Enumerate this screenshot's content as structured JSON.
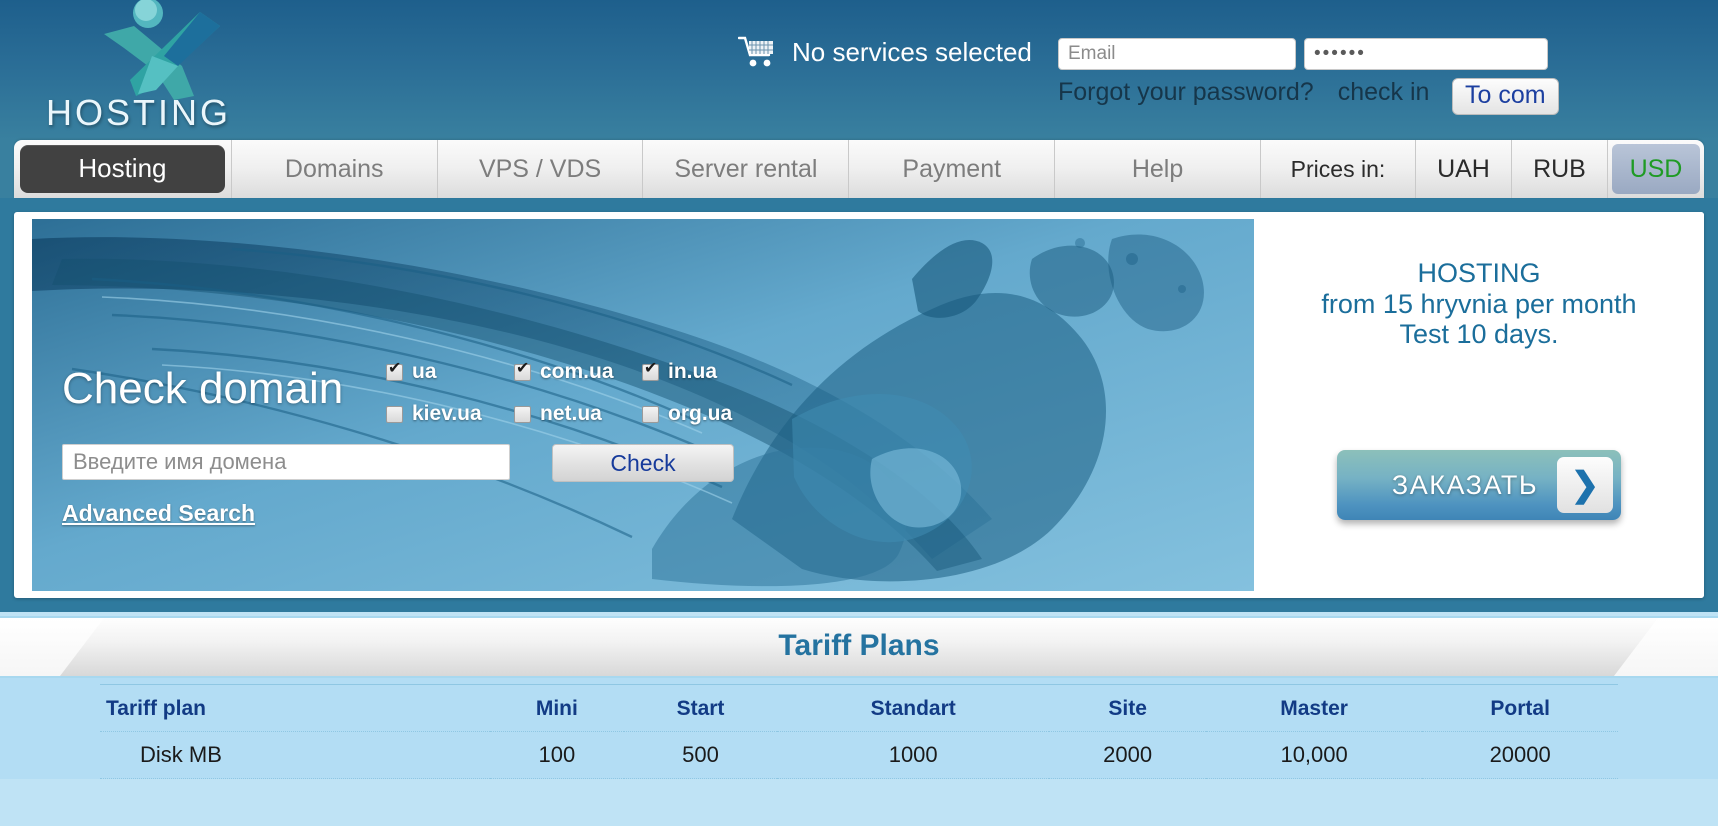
{
  "header": {
    "logo_text": "HOSTING",
    "cart": {
      "icon": "shopping-cart-icon",
      "label": "No services selected"
    },
    "login": {
      "email_placeholder": "Email",
      "email_value": "",
      "password_value": "••••••",
      "forgot_link": "Forgot your password?",
      "checkin_link": "check in",
      "submit_label": "To com"
    }
  },
  "nav": {
    "tabs": [
      {
        "label": "Hosting",
        "active": true
      },
      {
        "label": "Domains",
        "active": false
      },
      {
        "label": "VPS / VDS",
        "active": false
      },
      {
        "label": "Server rental",
        "active": false
      },
      {
        "label": "Payment",
        "active": false
      },
      {
        "label": "Help",
        "active": false
      }
    ],
    "prices_label": "Prices in:",
    "currencies": [
      {
        "code": "UAH",
        "active": false
      },
      {
        "code": "RUB",
        "active": false
      },
      {
        "code": "USD",
        "active": true
      }
    ]
  },
  "hero": {
    "title": "Check domain",
    "zones": [
      {
        "label": "ua",
        "checked": true
      },
      {
        "label": "com.ua",
        "checked": true
      },
      {
        "label": "in.ua",
        "checked": true
      },
      {
        "label": "kiev.ua",
        "checked": false
      },
      {
        "label": "net.ua",
        "checked": false
      },
      {
        "label": "org.ua",
        "checked": false
      }
    ],
    "domain_placeholder": "Введите имя домена",
    "domain_value": "",
    "check_button": "Check",
    "advanced_search": "Advanced Search"
  },
  "promo": {
    "line1": "HOSTING",
    "line2": "from 15 hryvnia per month",
    "line3": "Test 10 days.",
    "order_button": "ЗАКАЗАТЬ",
    "order_arrow": "❯"
  },
  "tariff": {
    "section_title": "Tariff Plans",
    "columns": [
      "Tariff plan",
      "Mini",
      "Start",
      "Standart",
      "Site",
      "Master",
      "Portal"
    ],
    "rows": [
      [
        "Disk MB",
        "100",
        "500",
        "1000",
        "2000",
        "10,000",
        "20000"
      ]
    ]
  },
  "colors": {
    "header_top": "#1e5f8c",
    "header_bottom": "#39809f",
    "accent_blue": "#2573a0",
    "active_tab": "#414141",
    "usd_green": "#1f9b24",
    "table_bg": "#b3ddf4"
  }
}
